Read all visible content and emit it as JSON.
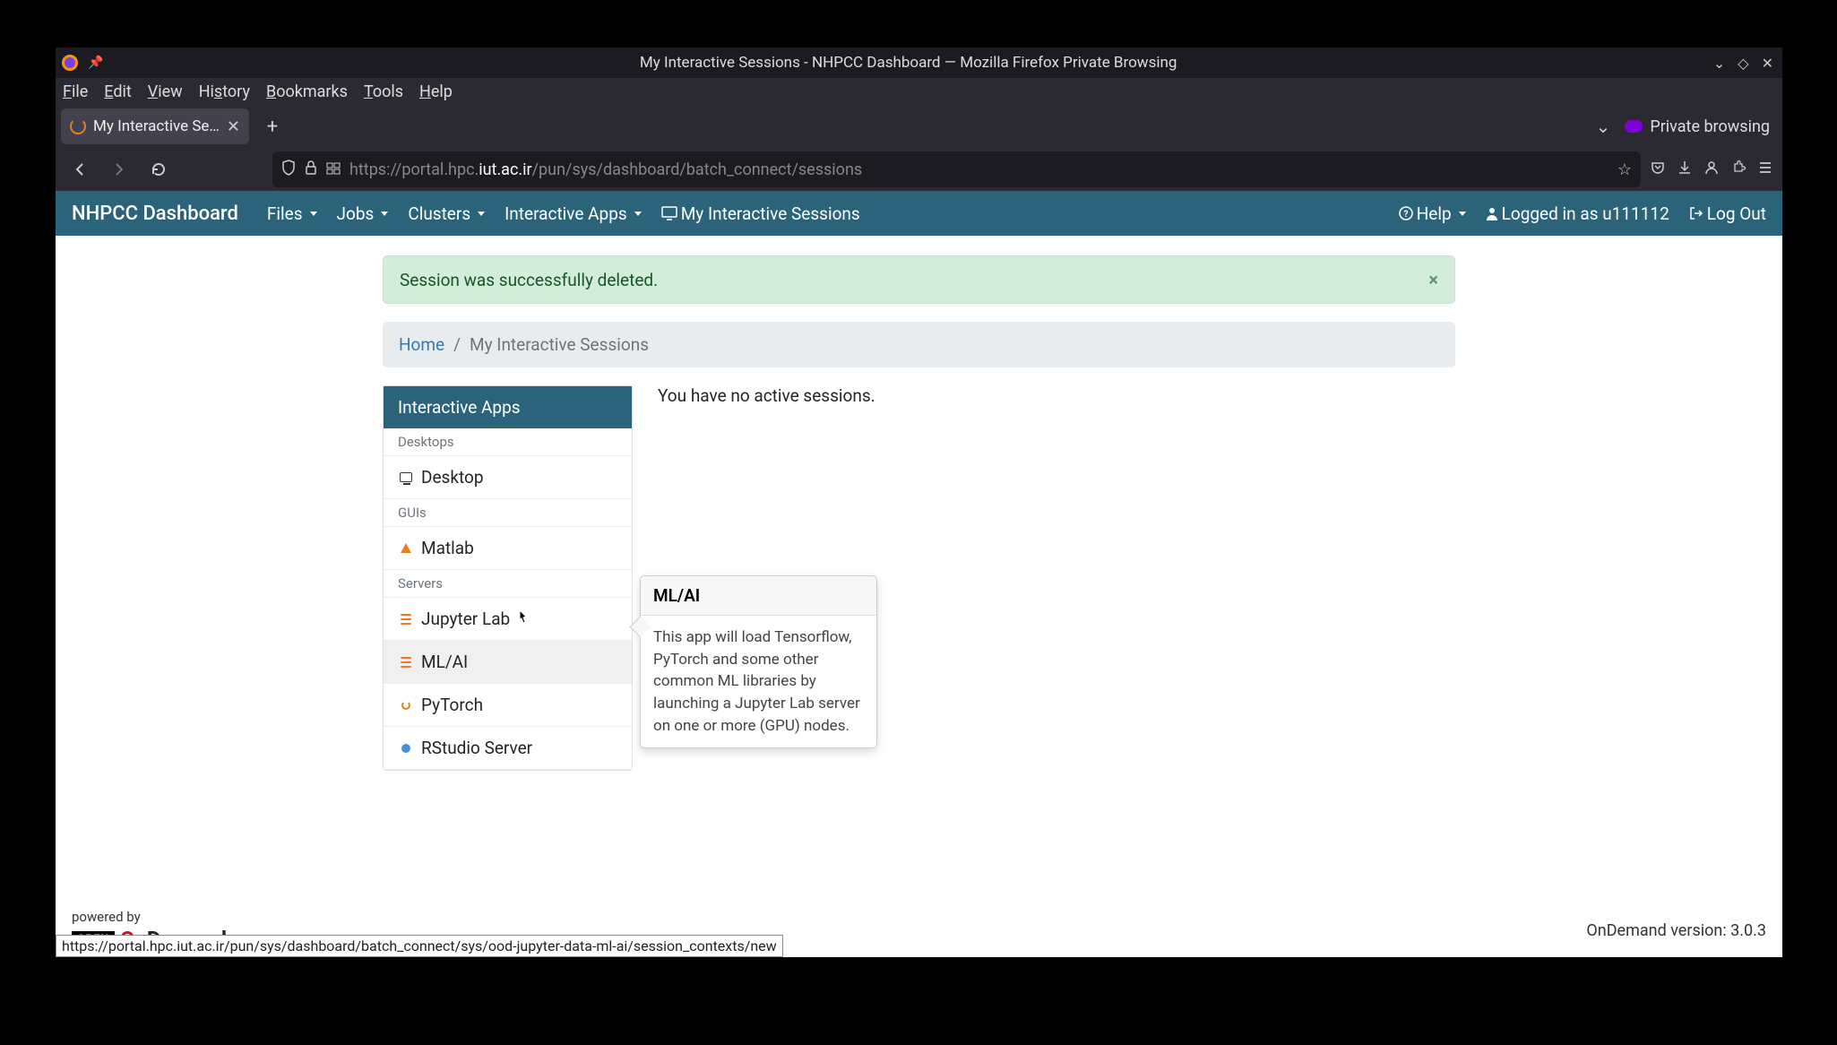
{
  "window": {
    "title": "My Interactive Sessions - NHPCC Dashboard — Mozilla Firefox Private Browsing"
  },
  "menubar": [
    "File",
    "Edit",
    "View",
    "History",
    "Bookmarks",
    "Tools",
    "Help"
  ],
  "tab": {
    "label": "My Interactive Sessions - N"
  },
  "private_label": "Private browsing",
  "url": {
    "protocol": "https://",
    "host_prefix": "portal.hpc.",
    "host_main": "iut.ac.ir",
    "path": "/pun/sys/dashboard/batch_connect/sessions"
  },
  "navbar": {
    "brand": "NHPCC Dashboard",
    "items": [
      "Files",
      "Jobs",
      "Clusters",
      "Interactive Apps"
    ],
    "my_sessions": "My Interactive Sessions",
    "help": "Help",
    "logged_in": "Logged in as u111112",
    "logout": "Log Out"
  },
  "alert": "Session was successfully deleted.",
  "breadcrumb": {
    "home": "Home",
    "current": "My Interactive Sessions"
  },
  "sidebar": {
    "header": "Interactive Apps",
    "groups": [
      {
        "label": "Desktops",
        "items": [
          {
            "name": "Desktop",
            "icon": "desktop"
          }
        ]
      },
      {
        "label": "GUIs",
        "items": [
          {
            "name": "Matlab",
            "icon": "matlab"
          }
        ]
      },
      {
        "label": "Servers",
        "items": [
          {
            "name": "Jupyter Lab",
            "icon": "jupyter"
          },
          {
            "name": "ML/AI",
            "icon": "jupyter",
            "hover": true
          },
          {
            "name": "PyTorch",
            "icon": "orange-circle"
          },
          {
            "name": "RStudio Server",
            "icon": "blue-circle"
          }
        ]
      }
    ]
  },
  "main": {
    "no_sessions": "You have no active sessions."
  },
  "tooltip": {
    "title": "ML/AI",
    "body": "This app will load Tensorflow, PyTorch and some other common ML libraries by launching a Jupyter Lab server on one or more (GPU) nodes."
  },
  "footer": {
    "powered": "powered by",
    "open": "OPEN",
    "ondemand": "nDemand",
    "version": "OnDemand version: 3.0.3"
  },
  "status_url": "https://portal.hpc.iut.ac.ir/pun/sys/dashboard/batch_connect/sys/ood-jupyter-data-ml-ai/session_contexts/new"
}
